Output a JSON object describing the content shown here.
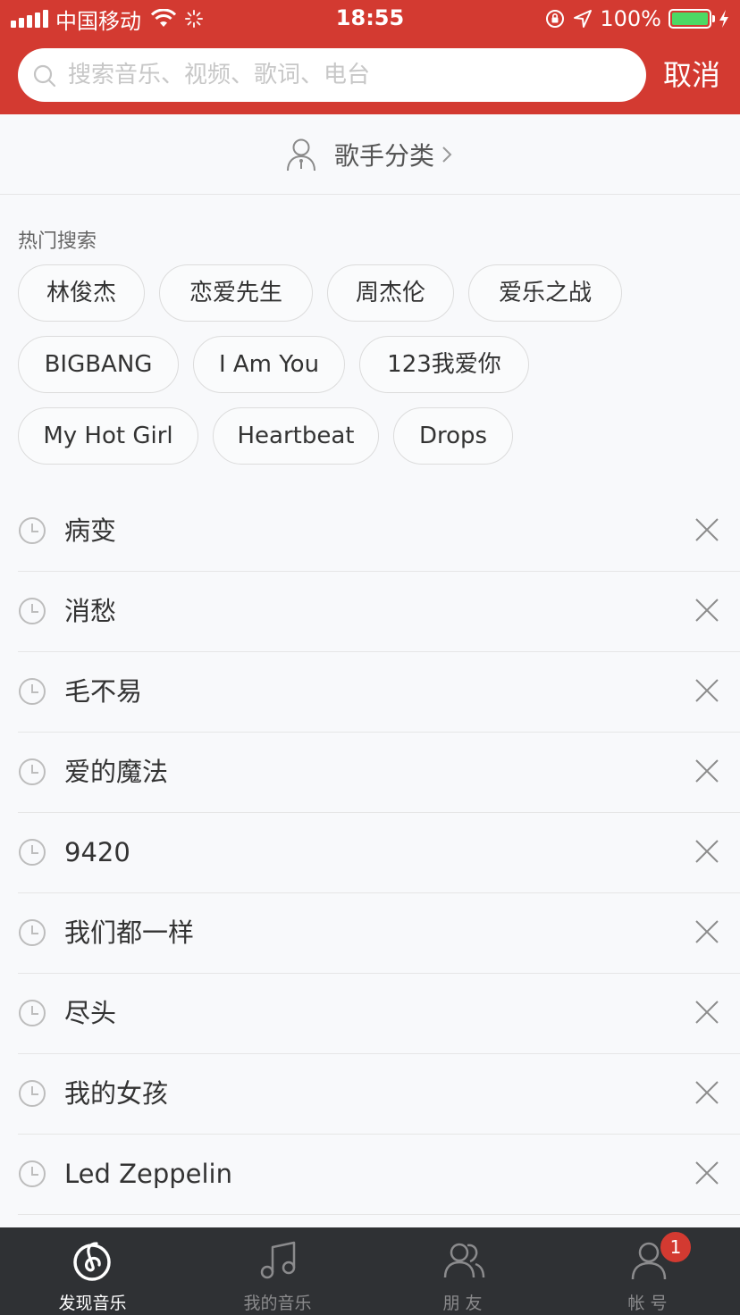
{
  "status_bar": {
    "carrier": "中国移动",
    "time": "18:55",
    "battery": "100%"
  },
  "search": {
    "placeholder": "搜索音乐、视频、歌词、电台",
    "cancel_label": "取消"
  },
  "singer_category": {
    "label": "歌手分类"
  },
  "hot_search": {
    "title": "热门搜索",
    "tags": [
      "林俊杰",
      "恋爱先生",
      "周杰伦",
      "爱乐之战",
      "BIGBANG",
      "I Am You",
      "123我爱你",
      "My Hot Girl",
      "Heartbeat",
      "Drops"
    ]
  },
  "history": {
    "items": [
      "病变",
      "消愁",
      "毛不易",
      "爱的魔法",
      "9420",
      "我们都一样",
      "尽头",
      "我的女孩",
      "Led Zeppelin"
    ]
  },
  "tabbar": {
    "tabs": [
      {
        "label": "发现音乐",
        "icon": "netease-music-logo-icon",
        "active": true
      },
      {
        "label": "我的音乐",
        "icon": "music-note-icon",
        "active": false
      },
      {
        "label": "朋 友",
        "icon": "friends-icon",
        "active": false
      },
      {
        "label": "帐 号",
        "icon": "account-icon",
        "active": false
      }
    ],
    "account_badge": "1"
  },
  "colors": {
    "brand": "#d33a31",
    "tabbar_bg": "#2f3134",
    "battery_green": "#4cd964"
  }
}
